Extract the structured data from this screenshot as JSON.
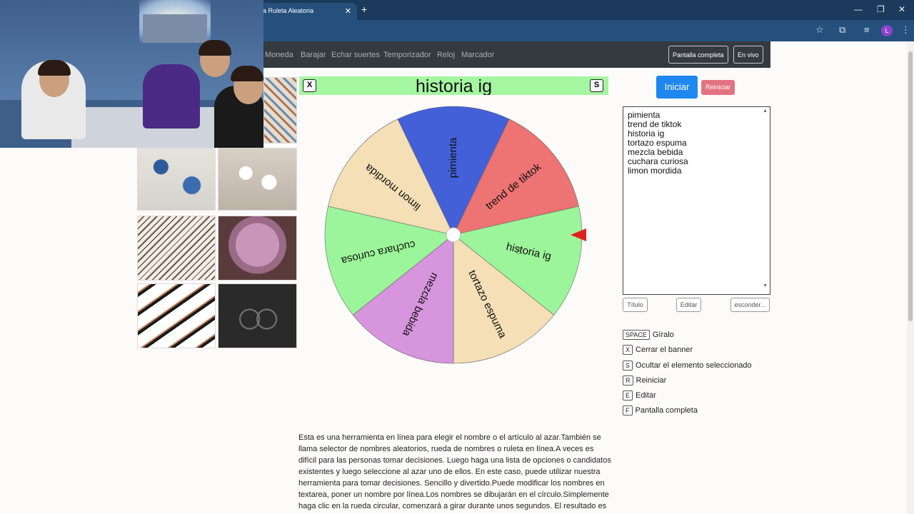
{
  "browser": {
    "tab_title": "a Ruleta Aleatoria",
    "tab_close": "✕",
    "new_tab": "+",
    "profile_initial": "L",
    "window_controls": [
      "—",
      "❐",
      "✕"
    ]
  },
  "site_nav": {
    "links": [
      "Moneda",
      "Barajar",
      "Echar suertes",
      "Temporizador",
      "Reloj",
      "Marcador"
    ],
    "fullscreen_button": "Pantalla completa",
    "live_button": "En vivo"
  },
  "banner": {
    "close_key": "X",
    "title": "historia ig",
    "hide_key": "S"
  },
  "wheel": {
    "segments": [
      {
        "label": "pimienta",
        "color": "#4460d8"
      },
      {
        "label": "trend de tiktok",
        "color": "#ee7373"
      },
      {
        "label": "historia ig",
        "color": "#9cf59a"
      },
      {
        "label": "tortazo espuma",
        "color": "#f4dfb6"
      },
      {
        "label": "mezcla bebida",
        "color": "#d795de"
      },
      {
        "label": "cuchara curiosa",
        "color": "#9cf59a"
      },
      {
        "label": "limon mordida",
        "color": "#f4dfb6"
      }
    ],
    "pointer_color": "#e0201e"
  },
  "controls": {
    "start_label": "Iniciar",
    "reset_label": "Reiniciar",
    "names": [
      "pimienta",
      "trend de tiktok",
      "historia ig",
      "tortazo espuma",
      "mezcla bebida",
      "cuchara curiosa",
      "limon mordida"
    ],
    "title_button": "Título",
    "edit_button": "Editar",
    "hide_button": "esconder..."
  },
  "shortcuts": [
    {
      "key": "SPACE",
      "label": "Gíralo"
    },
    {
      "key": "X",
      "label": "Cerrar el banner"
    },
    {
      "key": "S",
      "label": "Ocultar el elemento seleccionado"
    },
    {
      "key": "R",
      "label": "Reiniciar"
    },
    {
      "key": "E",
      "label": "Editar"
    },
    {
      "key": "F",
      "label": "Pantalla completa"
    }
  ],
  "description": "Esta es una herramienta en línea para elegir el nombre o el artículo al azar.También se llama selector de nombres aleatorios, rueda de nombres o ruleta en línea.A veces es difícil para las personas tomar decisiones. Luego haga una lista de opciones o candidatos existentes y luego seleccione al azar uno de ellos. En este caso, puede utilizar nuestra herramienta para tomar decisiones. Sencillo y divertido.Puede modificar los nombres en textarea, poner un nombre por línea.Los nombres se dibujarán en el círculo.Simplemente haga clic en la rueda circular, comenzará a girar durante unos segundos. El resultado es seleccionar al azar uno"
}
